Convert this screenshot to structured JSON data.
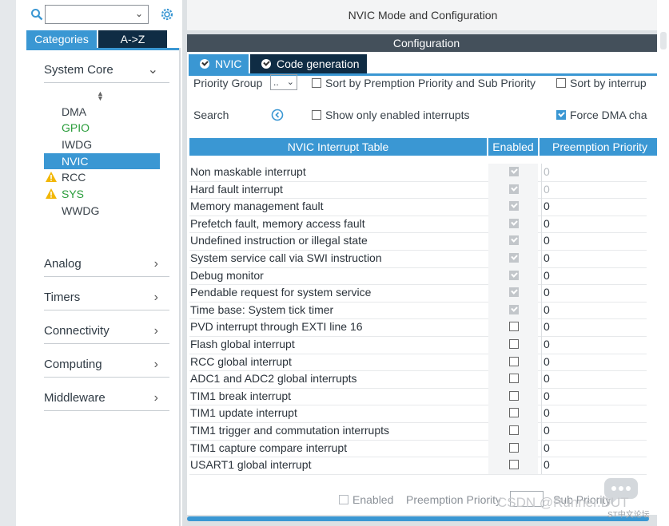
{
  "sidebar": {
    "search_value": "",
    "tabs": [
      "Categories",
      "A->Z"
    ],
    "sections_top": {
      "system_core": "System Core"
    },
    "peripherals": [
      {
        "label": "DMA",
        "color": "#39424a",
        "warning": false
      },
      {
        "label": "GPIO",
        "color": "#2a9d3b",
        "warning": false
      },
      {
        "label": "IWDG",
        "color": "#39424a",
        "warning": false
      },
      {
        "label": "NVIC",
        "color": "#ffffff",
        "warning": false,
        "selected": true
      },
      {
        "label": "RCC",
        "color": "#39424a",
        "warning": true
      },
      {
        "label": "SYS",
        "color": "#2a9d3b",
        "warning": true
      },
      {
        "label": "WWDG",
        "color": "#39424a",
        "warning": false
      }
    ],
    "sections": [
      "Analog",
      "Timers",
      "Connectivity",
      "Computing",
      "Middleware"
    ]
  },
  "main": {
    "mode_title": "NVIC Mode and Configuration",
    "config_title": "Configuration",
    "tabs": [
      "NVIC",
      "Code generation"
    ],
    "priority_group_label": "Priority Group",
    "priority_group_value": "..",
    "sort_premption_label": "Sort by Premption Priority and Sub Priority",
    "sort_interrupt_label": "Sort by interrup",
    "search_label": "Search",
    "show_enabled_label": "Show only enabled interrupts",
    "force_dma_label": "Force DMA cha",
    "table_headers": {
      "name": "NVIC Interrupt Table",
      "enabled": "Enabled",
      "preempt": "Preemption Priority"
    },
    "rows": [
      {
        "name": "Non maskable interrupt",
        "enabled": true,
        "locked": true,
        "preempt": "0",
        "dim": true
      },
      {
        "name": "Hard fault interrupt",
        "enabled": true,
        "locked": true,
        "preempt": "0",
        "dim": true
      },
      {
        "name": "Memory management fault",
        "enabled": true,
        "locked": true,
        "preempt": "0",
        "dim": false
      },
      {
        "name": "Prefetch fault, memory access fault",
        "enabled": true,
        "locked": true,
        "preempt": "0",
        "dim": false
      },
      {
        "name": "Undefined instruction or illegal state",
        "enabled": true,
        "locked": true,
        "preempt": "0",
        "dim": false
      },
      {
        "name": "System service call via SWI instruction",
        "enabled": true,
        "locked": true,
        "preempt": "0",
        "dim": false
      },
      {
        "name": "Debug monitor",
        "enabled": true,
        "locked": true,
        "preempt": "0",
        "dim": false
      },
      {
        "name": "Pendable request for system service",
        "enabled": true,
        "locked": true,
        "preempt": "0",
        "dim": false
      },
      {
        "name": "Time base: System tick timer",
        "enabled": true,
        "locked": true,
        "preempt": "0",
        "dim": false
      },
      {
        "name": "PVD interrupt through EXTI line 16",
        "enabled": false,
        "locked": false,
        "preempt": "0",
        "dim": false
      },
      {
        "name": "Flash global interrupt",
        "enabled": false,
        "locked": false,
        "preempt": "0",
        "dim": false
      },
      {
        "name": "RCC global interrupt",
        "enabled": false,
        "locked": false,
        "preempt": "0",
        "dim": false
      },
      {
        "name": "ADC1 and ADC2 global interrupts",
        "enabled": false,
        "locked": false,
        "preempt": "0",
        "dim": false
      },
      {
        "name": "TIM1 break interrupt",
        "enabled": false,
        "locked": false,
        "preempt": "0",
        "dim": false
      },
      {
        "name": "TIM1 update interrupt",
        "enabled": false,
        "locked": false,
        "preempt": "0",
        "dim": false
      },
      {
        "name": "TIM1 trigger and commutation interrupts",
        "enabled": false,
        "locked": false,
        "preempt": "0",
        "dim": false
      },
      {
        "name": "TIM1 capture compare interrupt",
        "enabled": false,
        "locked": false,
        "preempt": "0",
        "dim": false
      },
      {
        "name": "USART1 global interrupt",
        "enabled": false,
        "locked": false,
        "preempt": "0",
        "dim": false
      }
    ],
    "footer": {
      "enabled_label": "Enabled",
      "preempt_label": "Preemption Priority",
      "sub_priority_label": "Sub Priority"
    }
  },
  "watermark": {
    "text": "CSDN @Runner.DUT",
    "sub": "ST中文论坛"
  },
  "colors": {
    "accent": "#3a97d3",
    "dark_tab": "#0f2c44",
    "header_bar": "#44505b",
    "warning": "#f2b705"
  }
}
